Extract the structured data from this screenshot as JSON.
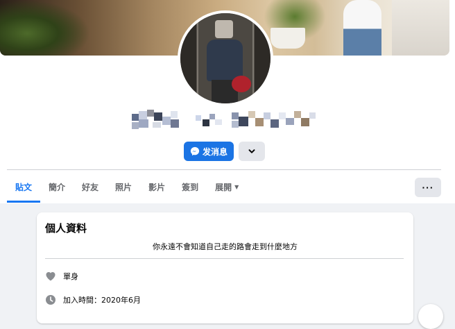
{
  "profile": {
    "actions": {
      "message_label": "发消息",
      "more_icon": "chevron-down-icon"
    }
  },
  "nav": {
    "tabs": [
      {
        "label": "貼文",
        "active": true
      },
      {
        "label": "簡介",
        "active": false
      },
      {
        "label": "好友",
        "active": false
      },
      {
        "label": "照片",
        "active": false
      },
      {
        "label": "影片",
        "active": false
      },
      {
        "label": "簽到",
        "active": false
      },
      {
        "label": "展開",
        "active": false
      }
    ],
    "more_label": "···"
  },
  "intro": {
    "title": "個人資料",
    "bio": "你永遠不會知道自己走的路會走到什麼地方",
    "items": [
      {
        "icon": "heart-icon",
        "text": "單身"
      },
      {
        "icon": "clock-icon",
        "text": "加入時間：2020年6月"
      }
    ]
  },
  "colors": {
    "accent": "#1877f2",
    "button_primary": "#1b74e4",
    "button_secondary": "#e4e6eb",
    "background": "#f0f2f5"
  }
}
